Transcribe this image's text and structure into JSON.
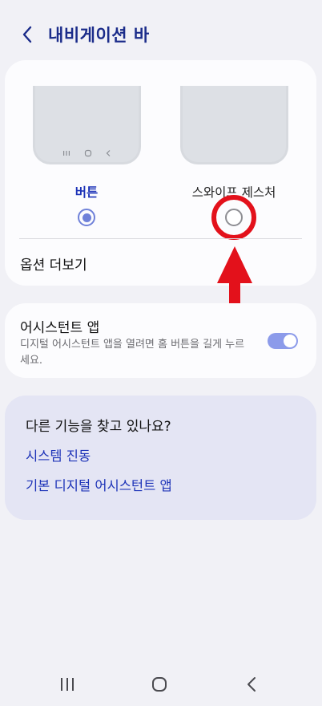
{
  "header": {
    "title": "내비게이션 바",
    "back_icon": "chevron-left-icon"
  },
  "navigation_types": {
    "options": [
      {
        "label": "버튼",
        "selected": true
      },
      {
        "label": "스와이프 제스처",
        "selected": false
      }
    ],
    "more_options": "옵션 더보기"
  },
  "assistant_app": {
    "title": "어시스턴트 앱",
    "description": "디지털 어시스턴트 앱을 열려면 홈 버튼을 길게 누르세요.",
    "enabled": true
  },
  "related": {
    "title": "다른 기능을 찾고 있나요?",
    "links": [
      "시스템 진동",
      "기본 디지털 어시스턴트 앱"
    ]
  },
  "colors": {
    "accent": "#1e34b8",
    "annotation_red": "#e3111b",
    "toggle_on": "#8c9bea"
  },
  "icons": {
    "system_nav": [
      "recents-icon",
      "home-icon",
      "back-icon"
    ]
  }
}
